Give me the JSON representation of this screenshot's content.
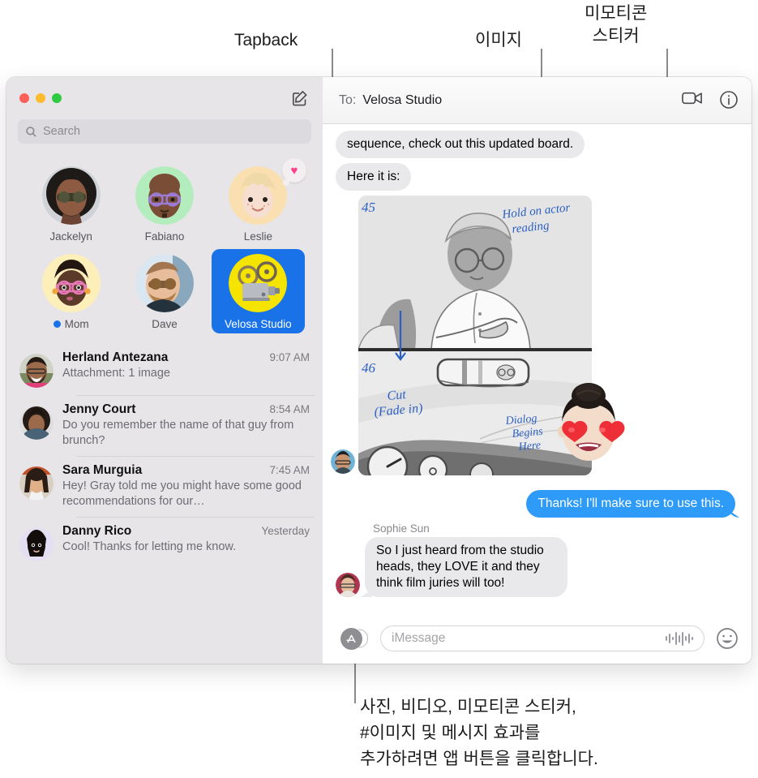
{
  "callouts": [
    {
      "id": "tapback",
      "text": "Tapback"
    },
    {
      "id": "image",
      "text": "이미지"
    },
    {
      "id": "memoji-sticker",
      "text": "미모티콘\n스티커"
    },
    {
      "id": "app-button",
      "text": "사진, 비디오, 미모티콘 스티커,\n#이미지 및 메시지 효과를\n추가하려면 앱 버튼을 클릭합니다."
    }
  ],
  "window": {
    "traffic_lights": {
      "close": "close-button",
      "minimize": "minimize-button",
      "zoom": "zoom-button"
    },
    "compose_icon": "compose-icon"
  },
  "sidebar": {
    "search": {
      "placeholder": "Search",
      "icon": "search-icon"
    },
    "pinned": [
      {
        "name": "Jackelyn",
        "avatar_type": "photo",
        "selected": false,
        "unread": false,
        "tapback": null
      },
      {
        "name": "Fabiano",
        "avatar_type": "memoji",
        "selected": false,
        "unread": false,
        "tapback": null
      },
      {
        "name": "Leslie",
        "avatar_type": "memoji",
        "selected": false,
        "unread": false,
        "tapback": "heart"
      },
      {
        "name": "Mom",
        "avatar_type": "memoji",
        "selected": false,
        "unread": true,
        "tapback": null
      },
      {
        "name": "Dave",
        "avatar_type": "photo",
        "selected": false,
        "unread": false,
        "tapback": null
      },
      {
        "name": "Velosa Studio",
        "avatar_type": "emoji",
        "selected": true,
        "unread": false,
        "tapback": null
      }
    ],
    "conversations": [
      {
        "name": "Herland Antezana",
        "time": "9:07 AM",
        "preview": "Attachment: 1 image"
      },
      {
        "name": "Jenny Court",
        "time": "8:54 AM",
        "preview": "Do you remember the name of that guy from brunch?"
      },
      {
        "name": "Sara Murguia",
        "time": "7:45 AM",
        "preview": "Hey! Gray told me you might have some good recommendations for our…"
      },
      {
        "name": "Danny Rico",
        "time": "Yesterday",
        "preview": "Cool! Thanks for letting me know."
      }
    ]
  },
  "conversation": {
    "header": {
      "to_label": "To:",
      "recipient": "Velosa Studio",
      "facetime_icon": "video-camera-icon",
      "info_icon": "info-icon"
    },
    "messages": [
      {
        "type": "in",
        "text": "sequence, check out this updated board."
      },
      {
        "type": "in",
        "text": "Here it is:"
      },
      {
        "type": "image",
        "alt": "storyboard-image",
        "annotations": [
          "45",
          "Hold on actor reading",
          "46",
          "Cut (Fade in)",
          "Dialog Begins Here"
        ],
        "sticker": "memoji-heart-eyes-sticker"
      },
      {
        "type": "out",
        "text": "Thanks! I'll make sure to use this."
      },
      {
        "type": "in",
        "sender": "Sophie Sun",
        "text": "So I just heard from the studio heads, they LOVE it and they think film juries will too!"
      }
    ],
    "composer": {
      "app_button": "app-store-button",
      "placeholder": "iMessage",
      "audio_icon": "audio-waveform-icon",
      "emoji_icon": "emoji-smiley-icon"
    }
  },
  "colors": {
    "accent_blue": "#1a72e8",
    "bubble_out": "#2e9bf8",
    "bubble_in": "#e9e9eb",
    "sidebar_bg": "#e7e5e8",
    "tapback_heart": "#f8418c",
    "traffic_red": "#fc6058",
    "traffic_yellow": "#fdbc2f",
    "traffic_green": "#2fca42"
  }
}
